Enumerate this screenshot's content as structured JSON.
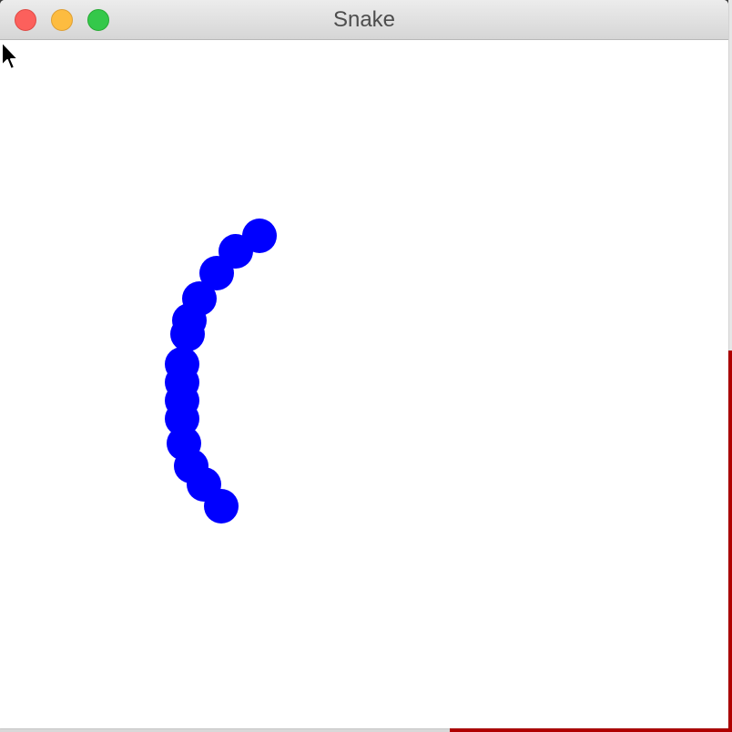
{
  "window": {
    "title": "Snake"
  },
  "colors": {
    "snake": "#0000ff",
    "background": "#ffffff"
  },
  "icons": {
    "close": "close-button",
    "minimize": "minimize-button",
    "zoom": "zoom-button",
    "cursor": "arrow-cursor-icon"
  }
}
